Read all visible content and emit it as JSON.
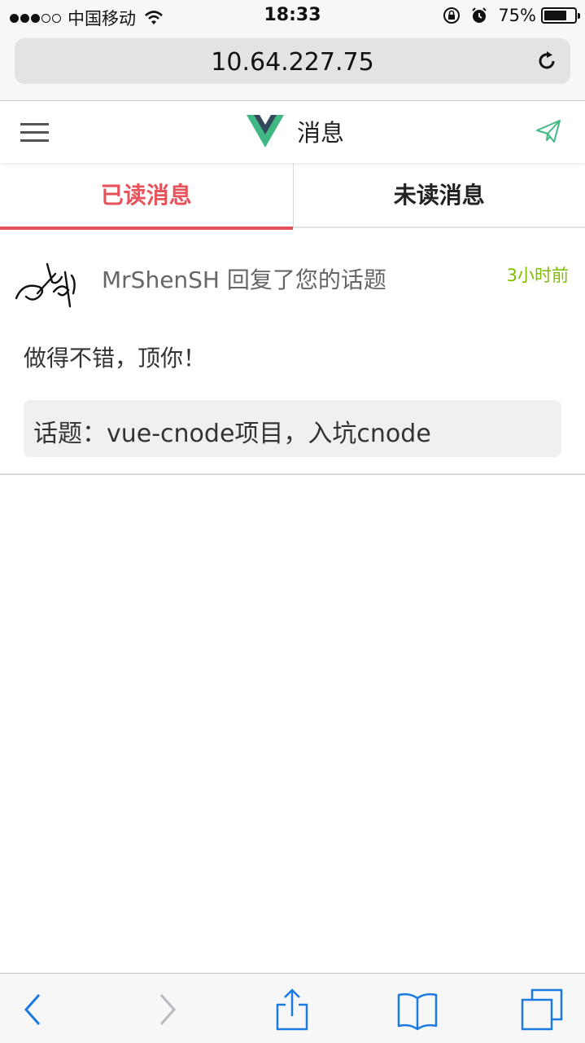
{
  "status_bar": {
    "carrier": "中国移动",
    "time": "18:33",
    "battery": "75%",
    "battery_level": 0.75,
    "icons": [
      "signal-dots-icon",
      "wifi-icon",
      "rotation-lock-icon",
      "alarm-icon",
      "battery-icon"
    ]
  },
  "browser": {
    "url": "10.64.227.75",
    "reload_icon": "reload-icon"
  },
  "header": {
    "title": "消息",
    "logo": "vue-logo-icon",
    "menu_icon": "hamburger-menu-icon",
    "action_icon": "send-paper-plane-icon",
    "logo_colors": {
      "outer": "#41b883",
      "inner": "#35495e"
    },
    "accent": "#41b883"
  },
  "tabs": [
    {
      "label": "已读消息",
      "active": true
    },
    {
      "label": "未读消息",
      "active": false
    }
  ],
  "colors": {
    "active_tab": "#e8525a",
    "time": "#80bd01",
    "ios_blue": "#1a7ae0"
  },
  "messages": [
    {
      "author": "MrShenSH",
      "action": "回复了您的话题",
      "time": "3小时前",
      "content": "做得不错，顶你！",
      "topic": "话题：vue-cnode项目，入坑cnode"
    }
  ],
  "toolbar": {
    "icons": [
      "back-icon",
      "forward-icon",
      "share-icon",
      "bookmarks-icon",
      "tabs-icon"
    ]
  }
}
